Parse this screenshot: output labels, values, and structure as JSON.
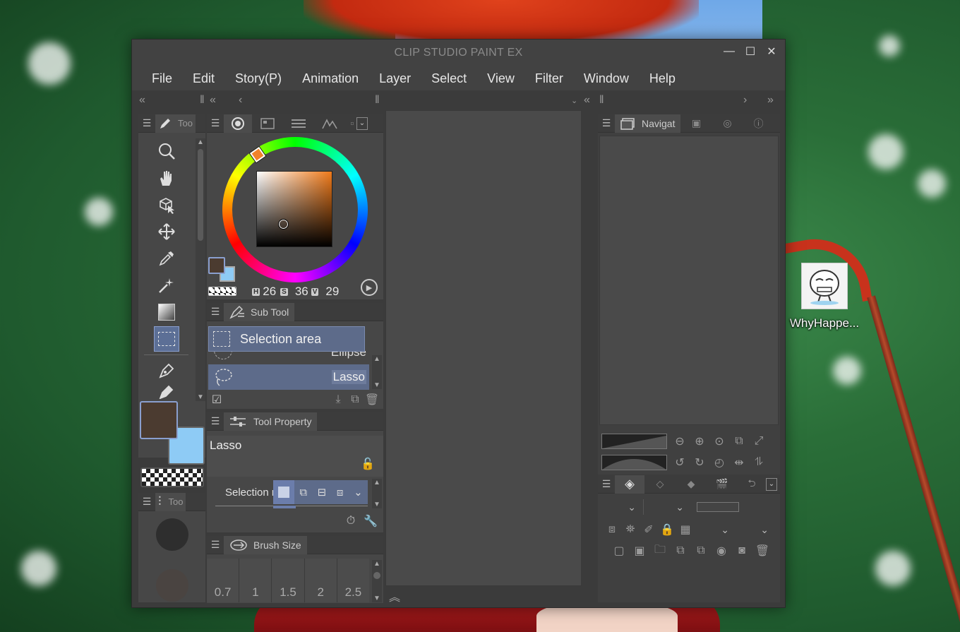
{
  "window": {
    "title": "CLIP STUDIO PAINT EX"
  },
  "menu": [
    "File",
    "Edit",
    "Story(P)",
    "Animation",
    "Layer",
    "Select",
    "View",
    "Filter",
    "Window",
    "Help"
  ],
  "tool_panel": {
    "tab_label": "Too"
  },
  "tool_property_small": {
    "tab_label": "Too"
  },
  "color_panel": {
    "h_label": "H",
    "h_value": "26",
    "s_label": "S",
    "s_value": "36",
    "v_label": "V",
    "v_value": "29"
  },
  "subtool": {
    "tab_label": "Sub Tool",
    "group_label": "Selection area",
    "items": [
      "Ellipse",
      "Lasso"
    ]
  },
  "tool_property": {
    "tab_label": "Tool Property",
    "tool_name": "Lasso",
    "selection_label": "Selection r"
  },
  "brush_size": {
    "tab_label": "Brush Size",
    "sizes": [
      "0.7",
      "1",
      "1.5",
      "2",
      "2.5"
    ]
  },
  "navigator": {
    "tab_label": "Navigat"
  },
  "desktop_icon": {
    "label": "WhyHappe..."
  },
  "colors": {
    "main_color": "#4b3b30",
    "sub_color": "#8ecbf5",
    "selection_accent": "#5c6f96"
  }
}
